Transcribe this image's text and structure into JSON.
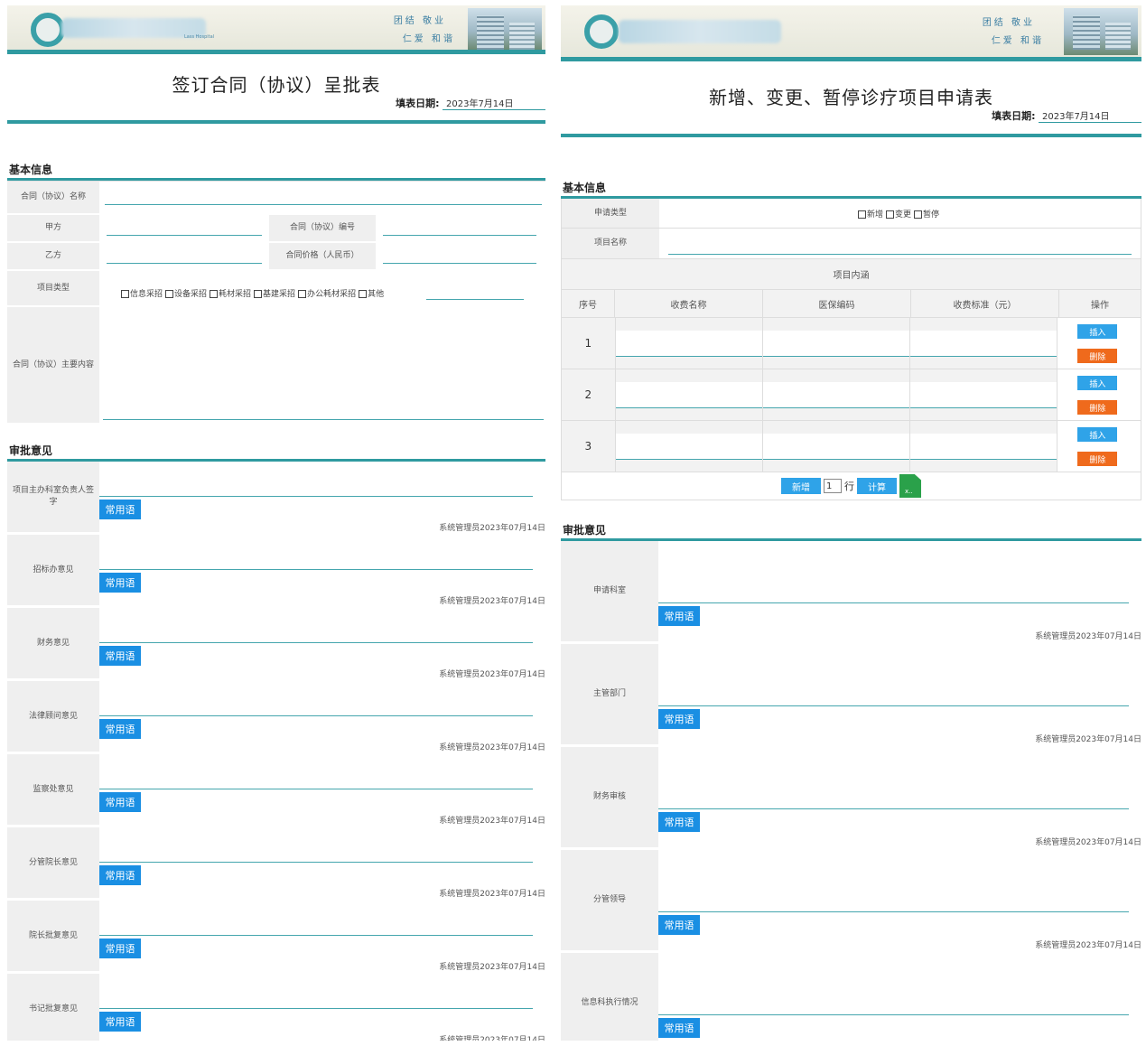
{
  "left": {
    "motto": [
      "团结  敬业",
      "仁爱  和谐"
    ],
    "subtitle_small": "Lass Hospital",
    "title": "签订合同（协议）呈批表",
    "date_label": "填表日期:",
    "date_value": "2023年7月14日",
    "basic_section": "基本信息",
    "fields": {
      "contract_name": "合同（协议）名称",
      "party_a": "甲方",
      "contract_no": "合同（协议）编号",
      "party_b": "乙方",
      "contract_price": "合同价格（人民币）",
      "project_type": "项目类型",
      "main_content": "合同（协议）主要内容"
    },
    "project_types": [
      "信息采招",
      "设备采招",
      "耗材采招",
      "基建采招",
      "办公耗材采招",
      "其他"
    ],
    "approval_section": "审批意见",
    "common_phrase": "常用语",
    "signature": "系统管理员2023年07月14日",
    "approvals": [
      "项目主办科室负责人签字",
      "招标办意见",
      "财务意见",
      "法律顾问意见",
      "监察处意见",
      "分管院长意见",
      "院长批复意见",
      "书记批复意见"
    ]
  },
  "right": {
    "motto": [
      "团结  敬业",
      "仁爱  和谐"
    ],
    "title": "新增、变更、暂停诊疗项目申请表",
    "date_label": "填表日期:",
    "date_value": "2023年7月14日",
    "basic_section": "基本信息",
    "apply_type_label": "申请类型",
    "apply_types": [
      "新增",
      "变更",
      "暂停"
    ],
    "project_name_label": "项目名称",
    "project_content": "项目内涵",
    "columns": [
      "序号",
      "收费名称",
      "医保编码",
      "收费标准（元）",
      "操作"
    ],
    "rows": [
      "1",
      "2",
      "3"
    ],
    "insert_label": "插入",
    "delete_label": "删除",
    "add_label": "新增",
    "rows_value": "1",
    "rows_unit": "行",
    "calc_label": "计算",
    "approval_section": "审批意见",
    "common_phrase": "常用语",
    "signature": "系统管理员2023年07月14日",
    "approvals": [
      "申请科室",
      "主管部门",
      "财务审核",
      "分管领导",
      "信息科执行情况"
    ]
  }
}
